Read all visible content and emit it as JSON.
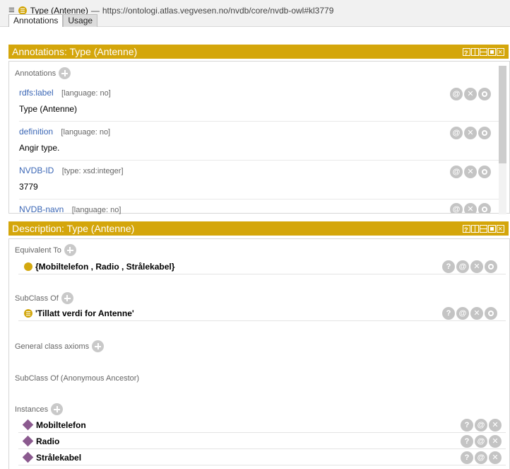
{
  "title": {
    "name": "Type (Antenne)",
    "separator": "—",
    "url": "https://ontologi.atlas.vegvesen.no/nvdb/core/nvdb-owl#kl3779"
  },
  "tabs": [
    {
      "label": "Annotations",
      "active": true
    },
    {
      "label": "Usage",
      "active": false
    }
  ],
  "annotations_panel": {
    "header": "Annotations: Type (Antenne)",
    "section_label": "Annotations",
    "items": [
      {
        "property": "rdfs:label",
        "qualifier": "[language: no]",
        "value": "Type (Antenne)"
      },
      {
        "property": "definition",
        "qualifier": "[language: no]",
        "value": "Angir type."
      },
      {
        "property": "NVDB-ID",
        "qualifier": "[type: xsd:integer]",
        "value": "3779"
      },
      {
        "property": "NVDB-navn",
        "qualifier": "[language: no]",
        "value": ""
      }
    ]
  },
  "description_panel": {
    "header": "Description: Type (Antenne)",
    "equivalent_to": {
      "label": "Equivalent To",
      "items": [
        "{Mobiltelefon , Radio , Strålekabel}"
      ]
    },
    "subclass_of": {
      "label": "SubClass Of",
      "items": [
        "'Tillatt verdi for Antenne'"
      ]
    },
    "general_class_axioms": {
      "label": "General class axioms"
    },
    "subclass_of_anonymous": {
      "label": "SubClass Of (Anonymous Ancestor)"
    },
    "instances": {
      "label": "Instances",
      "items": [
        "Mobiltelefon",
        "Radio",
        "Strålekabel"
      ]
    }
  },
  "icon_glyphs": {
    "help": "?",
    "annotate": "@",
    "delete": "✕"
  },
  "colors": {
    "header": "#d4a60b",
    "class": "#d3a80f",
    "individual": "#8b5a8f",
    "link": "#3a66b5"
  }
}
